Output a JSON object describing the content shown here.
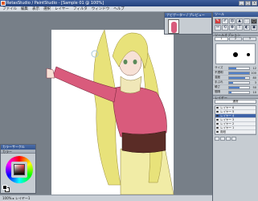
{
  "titlebar": {
    "title": "RetasStudio / PaintStudio - [Sample 01 @ 100%]",
    "btn_min": "_",
    "btn_max": "□",
    "btn_close": "×"
  },
  "menu": [
    "ファイル",
    "編集",
    "表示",
    "選択",
    "レイヤー",
    "フィルタ",
    "ウィンドウ",
    "ヘルプ"
  ],
  "status": {
    "text": "100%  ▸  レイヤー1"
  },
  "navigator": {
    "title": "ナビゲーター / プレビュー"
  },
  "left_panel": {
    "title": "カラーサークル",
    "subtitle": "カラー"
  },
  "right_panel": {
    "tools_title": "ツール",
    "tools": [
      "✎",
      "✐",
      "◍",
      "▲",
      "⬚",
      "◻",
      "✂",
      "⟲",
      "✥",
      "T",
      "◐",
      "▣"
    ],
    "tool_settings_title": "ツールオプション",
    "tabs": [
      "1",
      "2",
      "3"
    ],
    "props": [
      {
        "label": "サイズ",
        "value": "12",
        "fill": 0.35
      },
      {
        "label": "不透明",
        "value": "100",
        "fill": 1.0
      },
      {
        "label": "濃度",
        "value": "80",
        "fill": 0.8
      },
      {
        "label": "手ぶれ",
        "value": "3",
        "fill": 0.2
      },
      {
        "label": "硬さ",
        "value": "50",
        "fill": 0.5
      },
      {
        "label": "間隔",
        "value": "10",
        "fill": 0.1
      }
    ],
    "layers_title": "レイヤー",
    "blend_mode": "通常",
    "layers": [
      {
        "name": "レイヤー 6",
        "selected": false
      },
      {
        "name": "レイヤー 5",
        "selected": false
      },
      {
        "name": "レイヤー 4",
        "selected": true
      },
      {
        "name": "レイヤー 3",
        "selected": false
      },
      {
        "name": "レイヤー 2",
        "selected": false
      },
      {
        "name": "レイヤー 1",
        "selected": false
      },
      {
        "name": "用紙",
        "selected": false
      }
    ]
  },
  "colors": {
    "accent": "#d23b3b",
    "hair": "#e8e27a",
    "coat": "#d95b7c",
    "corset": "#5a2c26",
    "skirt": "#f1eca6"
  }
}
